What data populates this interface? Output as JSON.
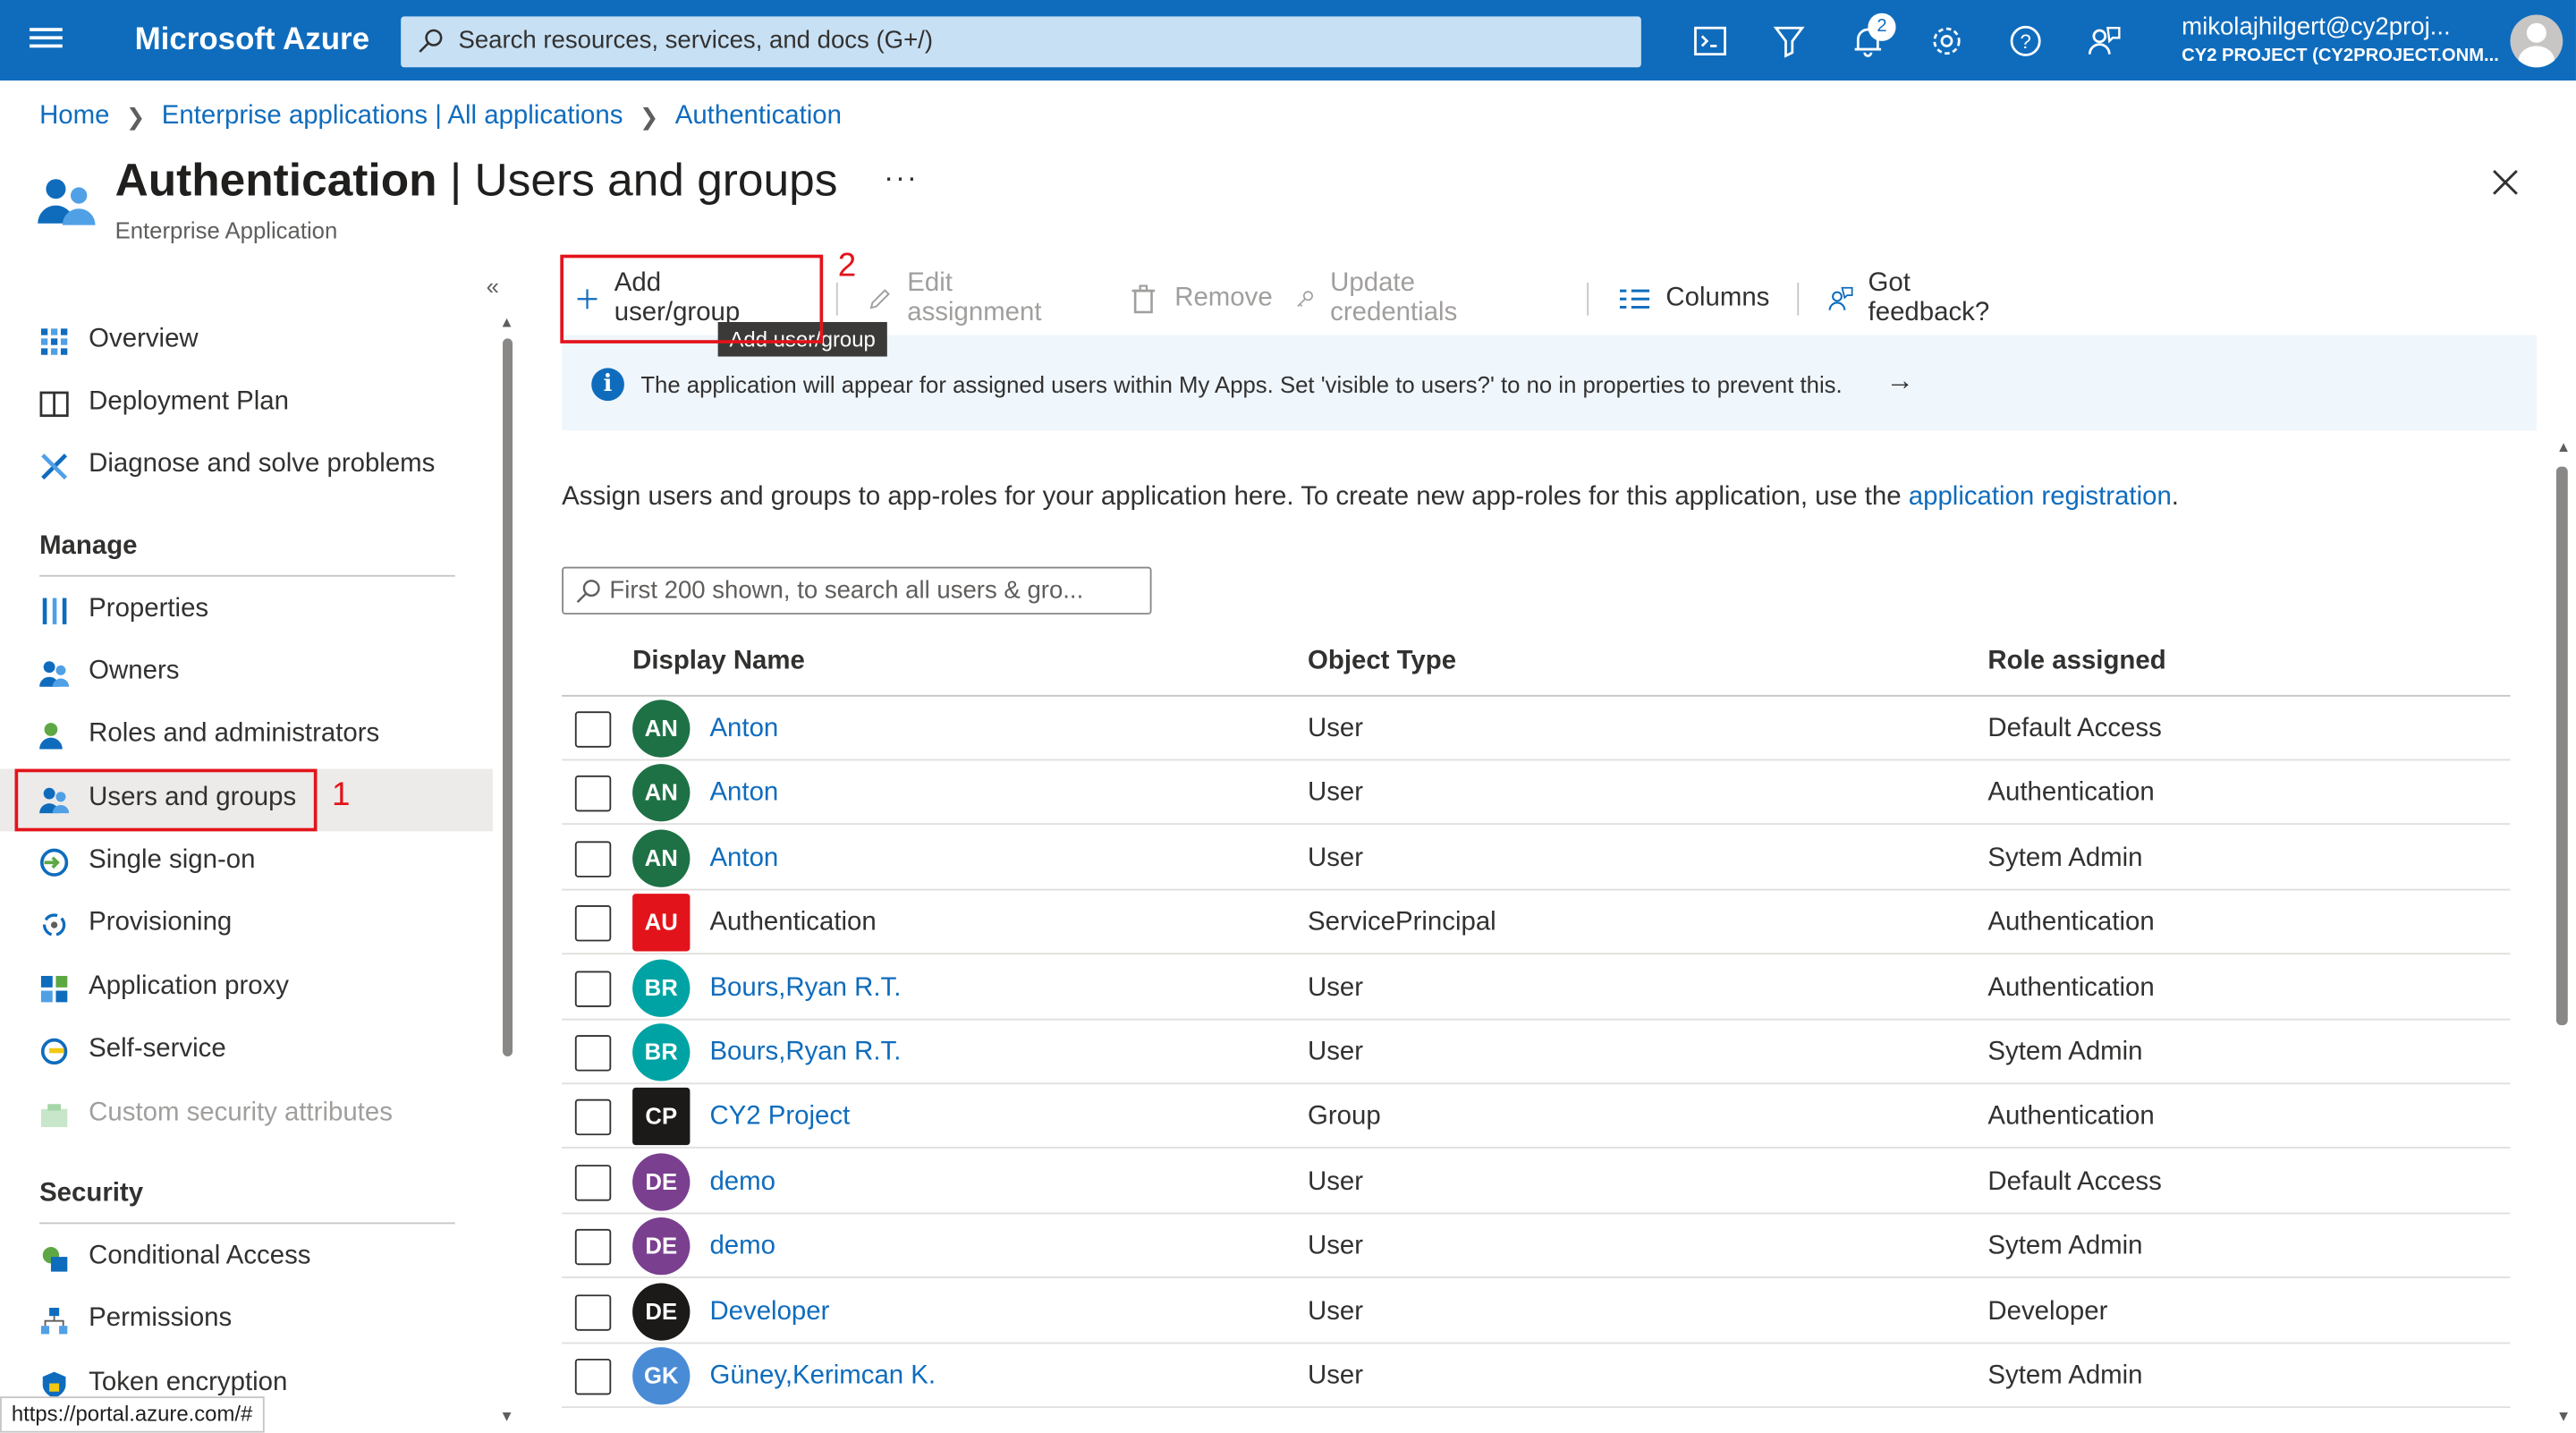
{
  "topbar": {
    "brand": "Microsoft Azure",
    "search_placeholder": "Search resources, services, and docs (G+/)",
    "notifications_count": "2",
    "account_email": "mikolajhilgert@cy2proj...",
    "account_tenant": "CY2 PROJECT (CY2PROJECT.ONM..."
  },
  "breadcrumb": [
    "Home",
    "Enterprise applications | All applications",
    "Authentication"
  ],
  "header": {
    "title_app": "Authentication",
    "title_sep": " | ",
    "title_page": "Users and groups",
    "subtitle": "Enterprise Application",
    "more": "···"
  },
  "sidebar": {
    "collapse": "«",
    "top_items": [
      {
        "label": "Overview",
        "icon": "overview-grid-icon"
      },
      {
        "label": "Deployment Plan",
        "icon": "book-icon"
      },
      {
        "label": "Diagnose and solve problems",
        "icon": "wrench-icon"
      }
    ],
    "sections": [
      {
        "title": "Manage",
        "items": [
          {
            "label": "Properties",
            "icon": "properties-icon"
          },
          {
            "label": "Owners",
            "icon": "owners-icon"
          },
          {
            "label": "Roles and administrators",
            "icon": "roles-icon"
          },
          {
            "label": "Users and groups",
            "icon": "users-groups-icon",
            "selected": true
          },
          {
            "label": "Single sign-on",
            "icon": "sso-icon"
          },
          {
            "label": "Provisioning",
            "icon": "provisioning-icon"
          },
          {
            "label": "Application proxy",
            "icon": "app-proxy-icon"
          },
          {
            "label": "Self-service",
            "icon": "self-service-icon"
          },
          {
            "label": "Custom security attributes",
            "icon": "custom-attributes-icon",
            "disabled": true
          }
        ]
      },
      {
        "title": "Security",
        "items": [
          {
            "label": "Conditional Access",
            "icon": "conditional-access-icon"
          },
          {
            "label": "Permissions",
            "icon": "permissions-icon"
          },
          {
            "label": "Token encryption",
            "icon": "shield-icon"
          }
        ]
      }
    ]
  },
  "annotations": {
    "one": "1",
    "two": "2"
  },
  "toolbar": {
    "add": "Add user/group",
    "edit": "Edit assignment",
    "remove": "Remove",
    "update": "Update credentials",
    "columns": "Columns",
    "feedback": "Got feedback?",
    "tooltip": "Add user/group"
  },
  "info": {
    "text": "The application will appear for assigned users within My Apps. Set 'visible to users?' to no in properties to prevent this.",
    "arrow": "→"
  },
  "description": {
    "text": "Assign users and groups to app-roles for your application here. To create new app-roles for this application, use the ",
    "link": "application registration",
    "end": "."
  },
  "filter": {
    "placeholder": "First 200 shown, to search all users & gro..."
  },
  "table": {
    "headers": {
      "name": "Display Name",
      "type": "Object Type",
      "role": "Role assigned"
    },
    "rows": [
      {
        "initials": "AN",
        "name": "Anton",
        "type": "User",
        "role": "Default Access",
        "color": "#1e7145",
        "shape": "circle",
        "link": true
      },
      {
        "initials": "AN",
        "name": "Anton",
        "type": "User",
        "role": "Authentication",
        "color": "#1e7145",
        "shape": "circle",
        "link": true
      },
      {
        "initials": "AN",
        "name": "Anton",
        "type": "User",
        "role": "Sytem Admin",
        "color": "#1e7145",
        "shape": "circle",
        "link": true
      },
      {
        "initials": "AU",
        "name": "Authentication",
        "type": "ServicePrincipal",
        "role": "Authentication",
        "color": "#e3131b",
        "shape": "square",
        "link": false
      },
      {
        "initials": "BR",
        "name": "Bours,Ryan R.T.",
        "type": "User",
        "role": "Authentication",
        "color": "#00a3a3",
        "shape": "circle",
        "link": true
      },
      {
        "initials": "BR",
        "name": "Bours,Ryan R.T.",
        "type": "User",
        "role": "Sytem Admin",
        "color": "#00a3a3",
        "shape": "circle",
        "link": true
      },
      {
        "initials": "CP",
        "name": "CY2 Project",
        "type": "Group",
        "role": "Authentication",
        "color": "#1b1a19",
        "shape": "square",
        "link": true
      },
      {
        "initials": "DE",
        "name": "demo",
        "type": "User",
        "role": "Default Access",
        "color": "#7a3f8f",
        "shape": "circle",
        "link": true
      },
      {
        "initials": "DE",
        "name": "demo",
        "type": "User",
        "role": "Sytem Admin",
        "color": "#7a3f8f",
        "shape": "circle",
        "link": true
      },
      {
        "initials": "DE",
        "name": "Developer",
        "type": "User",
        "role": "Developer",
        "color": "#1b1a19",
        "shape": "circle",
        "link": true
      },
      {
        "initials": "GK",
        "name": "Güney,Kerimcan K.",
        "type": "User",
        "role": "Sytem Admin",
        "color": "#4a8bd6",
        "shape": "circle",
        "link": true
      }
    ]
  },
  "statusbar": "https://portal.azure.com/#",
  "colors": {
    "accent": "#0f6cbd",
    "highlight": "#e3131b"
  }
}
